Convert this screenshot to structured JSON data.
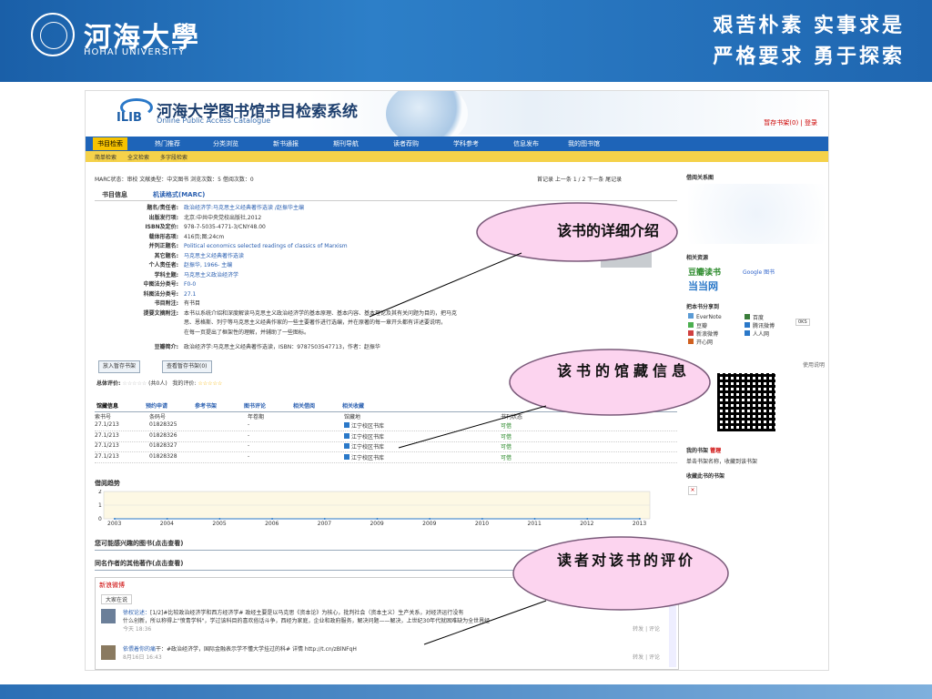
{
  "banner": {
    "uni_cn": "河海大學",
    "uni_en": "HOHAI UNIVERSITY",
    "motto_line1": "艰苦朴素 实事求是",
    "motto_line2": "严格要求 勇于探索"
  },
  "header": {
    "logo": "ILIB",
    "title": "河海大学图书馆书目检索系统",
    "subtitle": "Online Public Access Catalogue",
    "shelf_link": "暂存书架(0) | 登录"
  },
  "nav": {
    "items": [
      "书目检索",
      "热门推荐",
      "分类浏览",
      "新书通报",
      "期刊导航",
      "读者荐购",
      "学科参考",
      "信息发布",
      "我的图书馆"
    ]
  },
  "subnav": {
    "items": [
      "简单检索",
      "全文检索",
      "多字段检索"
    ]
  },
  "status": "MARC状态：审校    文献类型：中文图书    浏览次数：5    借阅次数：0",
  "pager": "首记录  上一条  1  /  2  下一条  尾记录",
  "tabs": [
    "书目信息",
    "机读格式(MARC)"
  ],
  "marc": [
    {
      "label": "题名/责任者:",
      "value": "政治经济学:马克思主义经典著作选读 /赵振华主编",
      "link": true
    },
    {
      "label": "出版发行项:",
      "value": "北京:中共中央党校出版社,2012",
      "link": false
    },
    {
      "label": "ISBN及定价:",
      "value": "978-7-5035-4771-3/CNY48.00",
      "link": false
    },
    {
      "label": "载体形态项:",
      "value": "416页;图;24cm",
      "link": false
    },
    {
      "label": "并列正题名:",
      "value": "Political economics selected readings of classics of Marxism",
      "link": true
    },
    {
      "label": "其它题名:",
      "value": "马克思主义经典著作选读",
      "link": true
    },
    {
      "label": "个人责任者:",
      "value": "赵振华, 1966- 主编",
      "link": true
    },
    {
      "label": "学科主题:",
      "value": "马克思主义政治经济学",
      "link": true
    },
    {
      "label": "中图法分类号:",
      "value": "F0-0",
      "link": true
    },
    {
      "label": "科图法分类号:",
      "value": "27.1",
      "link": true
    },
    {
      "label": "书目附注:",
      "value": "有书目",
      "link": false
    },
    {
      "label": "提要文摘附注:",
      "value": "本书以系统介绍和深度解读马克思主义政治经济学的基本原理、基本内容、基本理论及其有关问题为目的，把马克",
      "link": false
    },
    {
      "label": "",
      "value": "思、恩格斯、列宁等马克思主义经典作家的一些主要著作进行选编，并在原著的每一章开头都有详述要说明，",
      "link": false
    },
    {
      "label": "",
      "value": "在每一页提出了框架性的理解，并辅助了一些图标。",
      "link": false
    },
    {
      "label": "豆瓣简介:",
      "value": "政治经济学:马克思主义经典著作选读，ISBN：9787503547713，作者：赵振华",
      "link": false
    }
  ],
  "buttons": {
    "add_shelf": "放入暂存书架",
    "view_shelf": "查看暂存书架(0)"
  },
  "rating": {
    "label": "总体评价:",
    "stars": "☆☆☆☆☆",
    "count": "(共0人)",
    "my_label": "我的评价:",
    "my_stars": "☆☆☆☆☆"
  },
  "holdings": {
    "tabs": [
      "馆藏信息",
      "预约申请",
      "参考书架",
      "图书评论",
      "相关借阅",
      "相关收藏"
    ],
    "headers": [
      "索书号",
      "条码号",
      "年卷期",
      "馆藏地",
      "书刊状态"
    ],
    "rows": [
      [
        "27.1/213",
        "01828325",
        "-",
        "江宁校区书库",
        "可借"
      ],
      [
        "27.1/213",
        "01828326",
        "-",
        "江宁校区书库",
        "可借"
      ],
      [
        "27.1/213",
        "01828327",
        "-",
        "江宁校区书库",
        "可借"
      ],
      [
        "27.1/213",
        "01828328",
        "-",
        "江宁校区书库",
        "可借"
      ]
    ]
  },
  "chart_data": {
    "type": "line",
    "title": "借阅趋势",
    "categories": [
      "2003",
      "2004",
      "2005",
      "2006",
      "2007",
      "2009",
      "2009",
      "2010",
      "2011",
      "2012",
      "2013"
    ],
    "values": [
      0,
      0,
      0,
      0,
      0,
      0,
      0,
      0,
      0,
      0,
      0
    ],
    "yticks": [
      "0",
      "1",
      "2"
    ],
    "ylim": [
      0,
      2
    ],
    "grid": true
  },
  "sections": {
    "interest": "您可能感兴趣的图书(点击查看)",
    "same_author": "同名作者的其他著作(点击查看)"
  },
  "weibo": {
    "title": "新浪微博",
    "tab": "大家在说",
    "post1_name": "徐权论述：",
    "post1_text": "[1/2]#比较政治经济学和西方经济学# 政经主要是以马克思《资本论》为核心，批判社会（资本主义）生产关系，对经济运行没有",
    "post1_line2": "什么创新，所以称得上\"愤青学科\"，学过该科目的喜欢俗话斗争，西经为家庭，企业和政府服务，解决问题——解决，上世纪30年代就困难缺为全世界经",
    "post1_time": "今天 18:36",
    "post1_actions": "转发 | 评论",
    "post2_name": "依偎着你的痛",
    "post2_text": "干：#政治经济学，国际金融表示学不懂大学挂过的科# 详情 http://t.cn/zBlNFqH",
    "post2_time": "8月16日 16:43",
    "post2_actions": "转发 | 评论"
  },
  "right": {
    "relation": "借阅关系图",
    "resources": "相关资源",
    "douban": "豆瓣读书",
    "google": "Google 图书",
    "dangdang": "当当网",
    "share": "把本书分享到",
    "share_items": [
      "EverNote",
      "百度",
      "豆瓣",
      "腾讯微博",
      "新浪微博",
      "人人网",
      "开心网"
    ],
    "share_count": "0KS",
    "qr_label": "使用说明",
    "my_shelf": "我的书架",
    "manage": "管理",
    "shelf_tip": "单击书架名称，收藏到该书架",
    "collected": "收藏此书的书架"
  },
  "callouts": {
    "detail": "该书的详细介绍",
    "holdings": "该书的馆藏信息",
    "review": "读者对该书的评价"
  }
}
